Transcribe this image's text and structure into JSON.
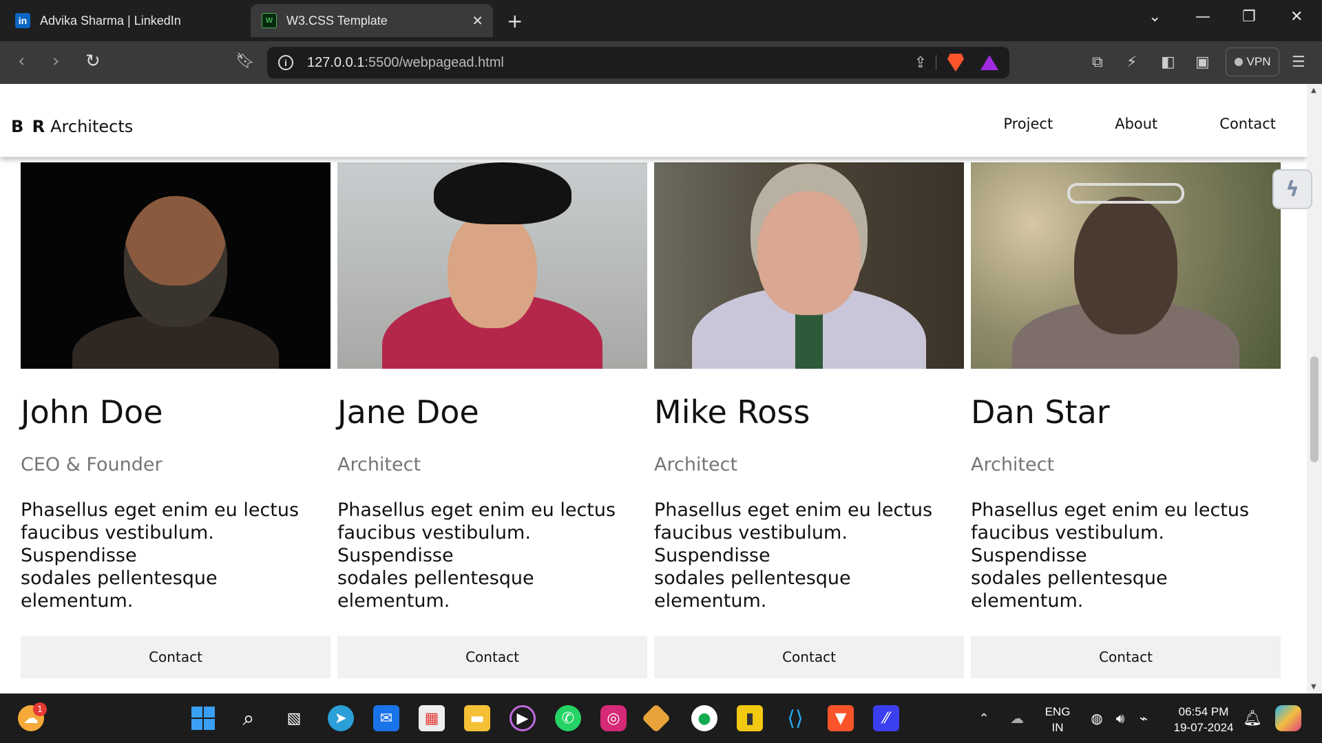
{
  "browser": {
    "tabs": [
      {
        "title": "Advika Sharma | LinkedIn",
        "favicon": "linkedin-icon"
      },
      {
        "title": "W3.CSS Template",
        "favicon": "w3css-icon",
        "active": true
      }
    ],
    "url_host": "127.0.0.1",
    "url_path": ":5500/webpagead.html",
    "vpn_label": "VPN"
  },
  "site": {
    "brand_bold": "B R",
    "brand_rest": "Architects",
    "nav": [
      "Project",
      "About",
      "Contact"
    ]
  },
  "team": [
    {
      "name": "John Doe",
      "role": "CEO & Founder",
      "desc_lines": [
        "Phasellus eget enim eu lectus",
        "faucibus vestibulum.",
        "Suspendisse",
        "sodales pellentesque",
        "elementum."
      ],
      "button": "Contact"
    },
    {
      "name": "Jane Doe",
      "role": "Architect",
      "desc_lines": [
        "Phasellus eget enim eu lectus",
        "faucibus vestibulum.",
        "Suspendisse",
        "sodales pellentesque",
        "elementum."
      ],
      "button": "Contact"
    },
    {
      "name": "Mike Ross",
      "role": "Architect",
      "desc_lines": [
        "Phasellus eget enim eu lectus",
        "faucibus vestibulum.",
        "Suspendisse",
        "sodales pellentesque",
        "elementum."
      ],
      "button": "Contact"
    },
    {
      "name": "Dan Star",
      "role": "Architect",
      "desc_lines": [
        "Phasellus eget enim eu lectus",
        "faucibus vestibulum.",
        "Suspendisse",
        "sodales pellentesque",
        "elementum."
      ],
      "button": "Contact"
    }
  ],
  "taskbar": {
    "badge_count": "1",
    "lang_top": "ENG",
    "lang_bottom": "IN",
    "time": "06:54 PM",
    "date": "19-07-2024"
  },
  "colors": {
    "accent_brave": "#fb542b",
    "linkedin": "#0a66c2",
    "taskbar": "#1c1c1c"
  }
}
